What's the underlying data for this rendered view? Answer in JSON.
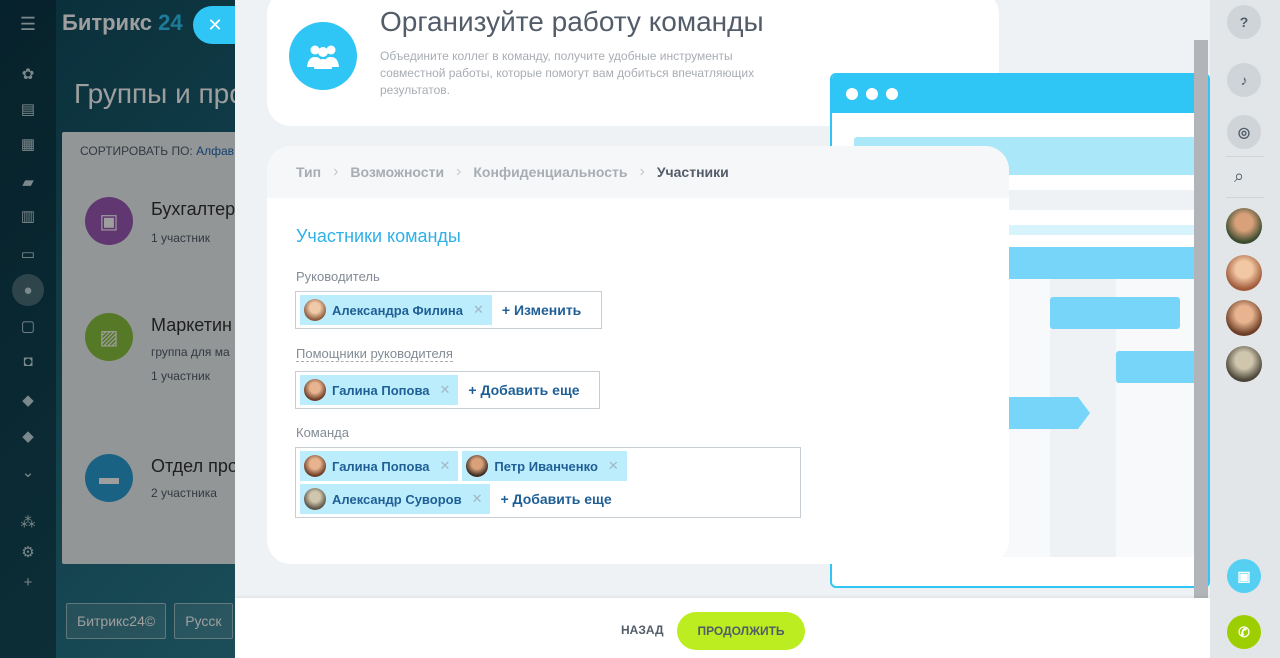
{
  "background": {
    "logo": "Битрикс",
    "logo_num": "24",
    "page_title": "Группы и про",
    "sort_label": "СОРТИРОВАТЬ ПО:",
    "sort_value": "Алфав",
    "groups": [
      {
        "name": "Бухгалтер",
        "sub": "1 участник",
        "color": "#9b59b6"
      },
      {
        "name": "Маркетин",
        "sub1": "группа для ма",
        "sub": "1 участник",
        "color": "#8ac43f"
      },
      {
        "name": "Отдел про",
        "sub": "2 участника",
        "color": "#2b9ed6"
      }
    ],
    "bottom_tabs": [
      "Битрикс24©",
      "Русск"
    ]
  },
  "header": {
    "title": "Организуйте работу команды",
    "description": "Объедините коллег в команду, получите удобные инструменты совместной работы, которые помогут вам добиться впечатляющих результатов.",
    "icon": "team-icon"
  },
  "steps": [
    {
      "label": "Тип"
    },
    {
      "label": "Возможности"
    },
    {
      "label": "Конфиденциальность"
    },
    {
      "label": "Участники"
    }
  ],
  "form": {
    "section_title": "Участники команды",
    "owner": {
      "label": "Руководитель",
      "tags": [
        "Александра Филина"
      ],
      "action": "+ Изменить"
    },
    "moderators": {
      "label": "Помощники руководителя",
      "tags": [
        "Галина Попова"
      ],
      "action": "+ Добавить еще"
    },
    "team": {
      "label": "Команда",
      "tags": [
        "Галина Попова",
        "Петр Иванченко",
        "Александр Суворов"
      ],
      "action": "+ Добавить еще"
    }
  },
  "footer": {
    "back": "НАЗАД",
    "continue": "ПРОДОЛЖИТЬ"
  },
  "colors": {
    "accent": "#2fc6f6",
    "continue_btn": "#bbed21",
    "tag_bg": "#bcedfc"
  }
}
